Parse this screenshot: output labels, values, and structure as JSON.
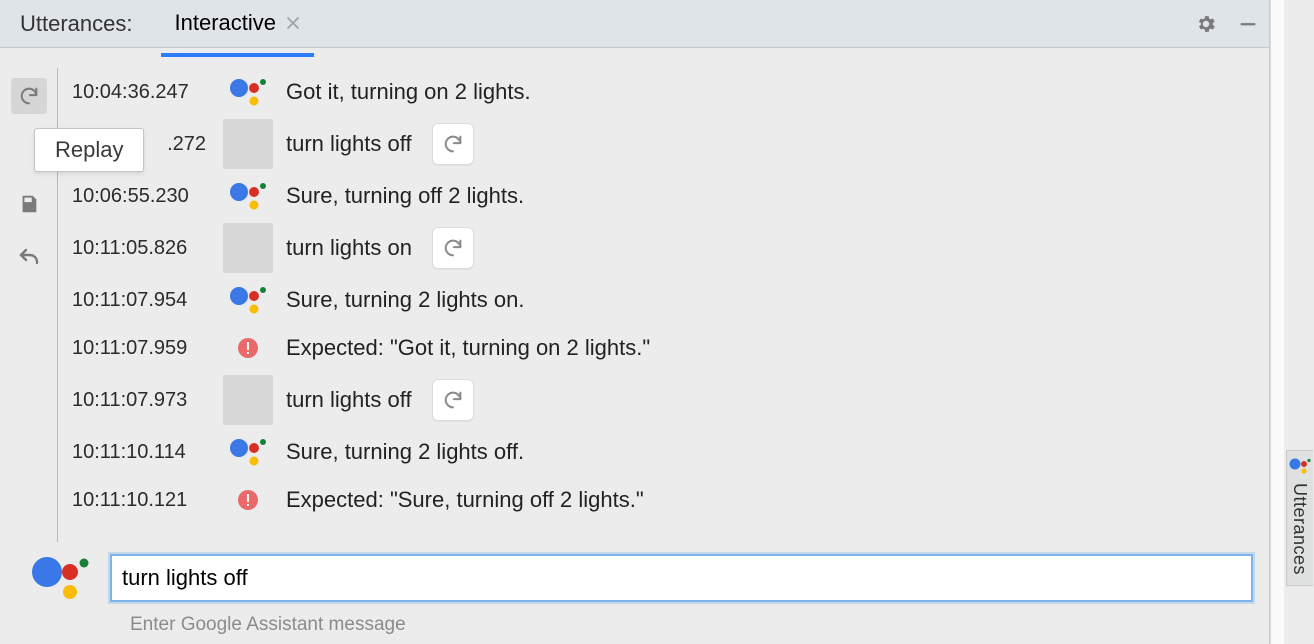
{
  "tabs": {
    "title_label": "Utterances:",
    "active_tab_label": "Interactive",
    "tooltip_replay": "Replay"
  },
  "log": [
    {
      "kind": "assistant",
      "ts": "10:04:36.247",
      "text": "Got it, turning on 2 lights."
    },
    {
      "kind": "user",
      "ts": ".272",
      "text": "turn lights off"
    },
    {
      "kind": "assistant",
      "ts": "10:06:55.230",
      "text": "Sure, turning off 2 lights."
    },
    {
      "kind": "user",
      "ts": "10:11:05.826",
      "text": "turn lights on"
    },
    {
      "kind": "assistant",
      "ts": "10:11:07.954",
      "text": "Sure, turning 2 lights on."
    },
    {
      "kind": "error",
      "ts": "10:11:07.959",
      "text": "Expected: \"Got it, turning on 2 lights.\""
    },
    {
      "kind": "user",
      "ts": "10:11:07.973",
      "text": "turn lights off"
    },
    {
      "kind": "assistant",
      "ts": "10:11:10.114",
      "text": "Sure, turning 2 lights off."
    },
    {
      "kind": "error",
      "ts": "10:11:10.121",
      "text": "Expected: \"Sure, turning off 2 lights.\""
    }
  ],
  "input": {
    "value": "turn lights off",
    "hint": "Enter Google Assistant message"
  },
  "side_tab": {
    "label": "Utterances"
  }
}
